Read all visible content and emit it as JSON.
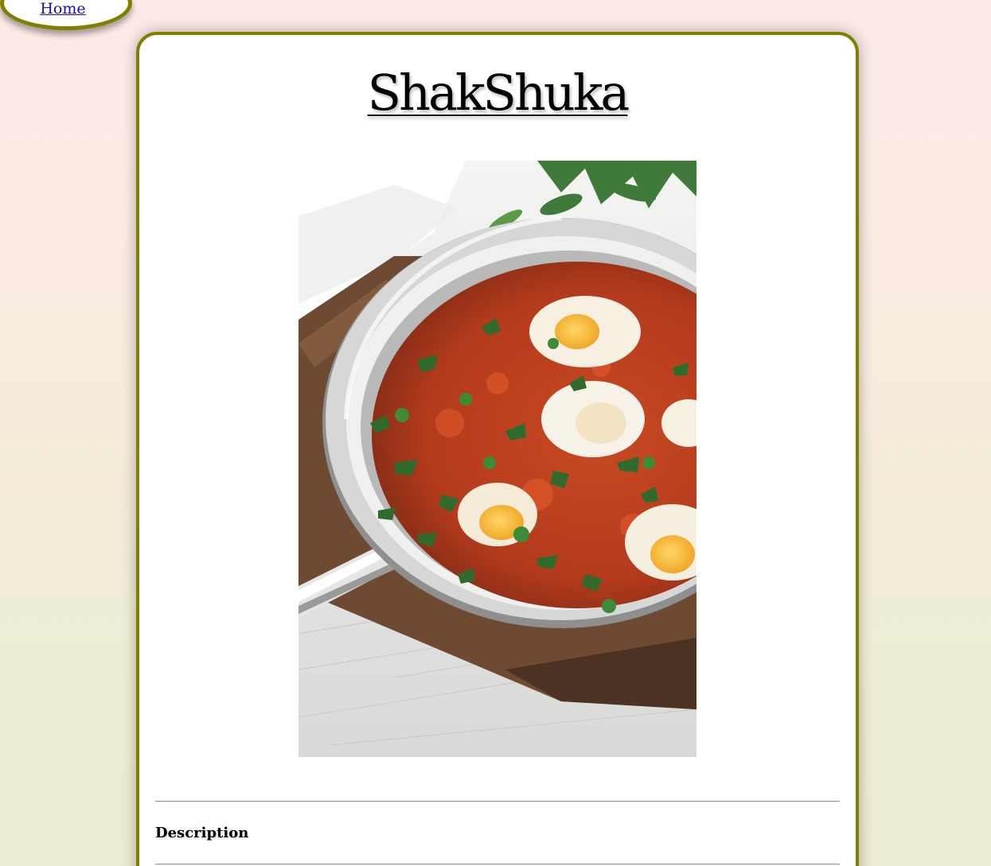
{
  "nav": {
    "home_label": "Home"
  },
  "recipe": {
    "title": "ShakShuka",
    "section_heading": "Description"
  },
  "colors": {
    "accent_border": "#808000",
    "card_background": "#ffffff",
    "link": "#1a0dab"
  },
  "icons": {
    "photo": "shakshuka-pan-photo"
  }
}
